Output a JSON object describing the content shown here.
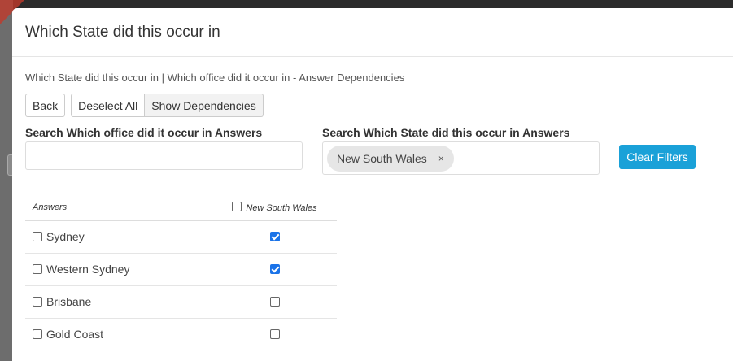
{
  "modal": {
    "title": "Which State did this occur in",
    "breadcrumb": "Which State did this occur in | Which office did it occur in - Answer Dependencies"
  },
  "buttons": {
    "back": "Back",
    "deselect_all": "Deselect All",
    "show_dependencies": "Show Dependencies",
    "clear_filters": "Clear Filters"
  },
  "search": {
    "office_label": "Search Which office did it occur in Answers",
    "office_value": "",
    "state_label": "Search Which State did this occur in Answers",
    "state_tags": [
      "New South Wales"
    ],
    "tag_remove_glyph": "×"
  },
  "table": {
    "col_answers": "Answers",
    "col_state": "New South Wales",
    "col_state_checked": false,
    "rows": [
      {
        "label": "Sydney",
        "row_checked": false,
        "state_checked": true
      },
      {
        "label": "Western Sydney",
        "row_checked": false,
        "state_checked": true
      },
      {
        "label": "Brisbane",
        "row_checked": false,
        "state_checked": false
      },
      {
        "label": "Gold Coast",
        "row_checked": false,
        "state_checked": false
      }
    ]
  },
  "colors": {
    "accent": "#1aa1d8",
    "checkbox_checked": "#1a73e8"
  }
}
